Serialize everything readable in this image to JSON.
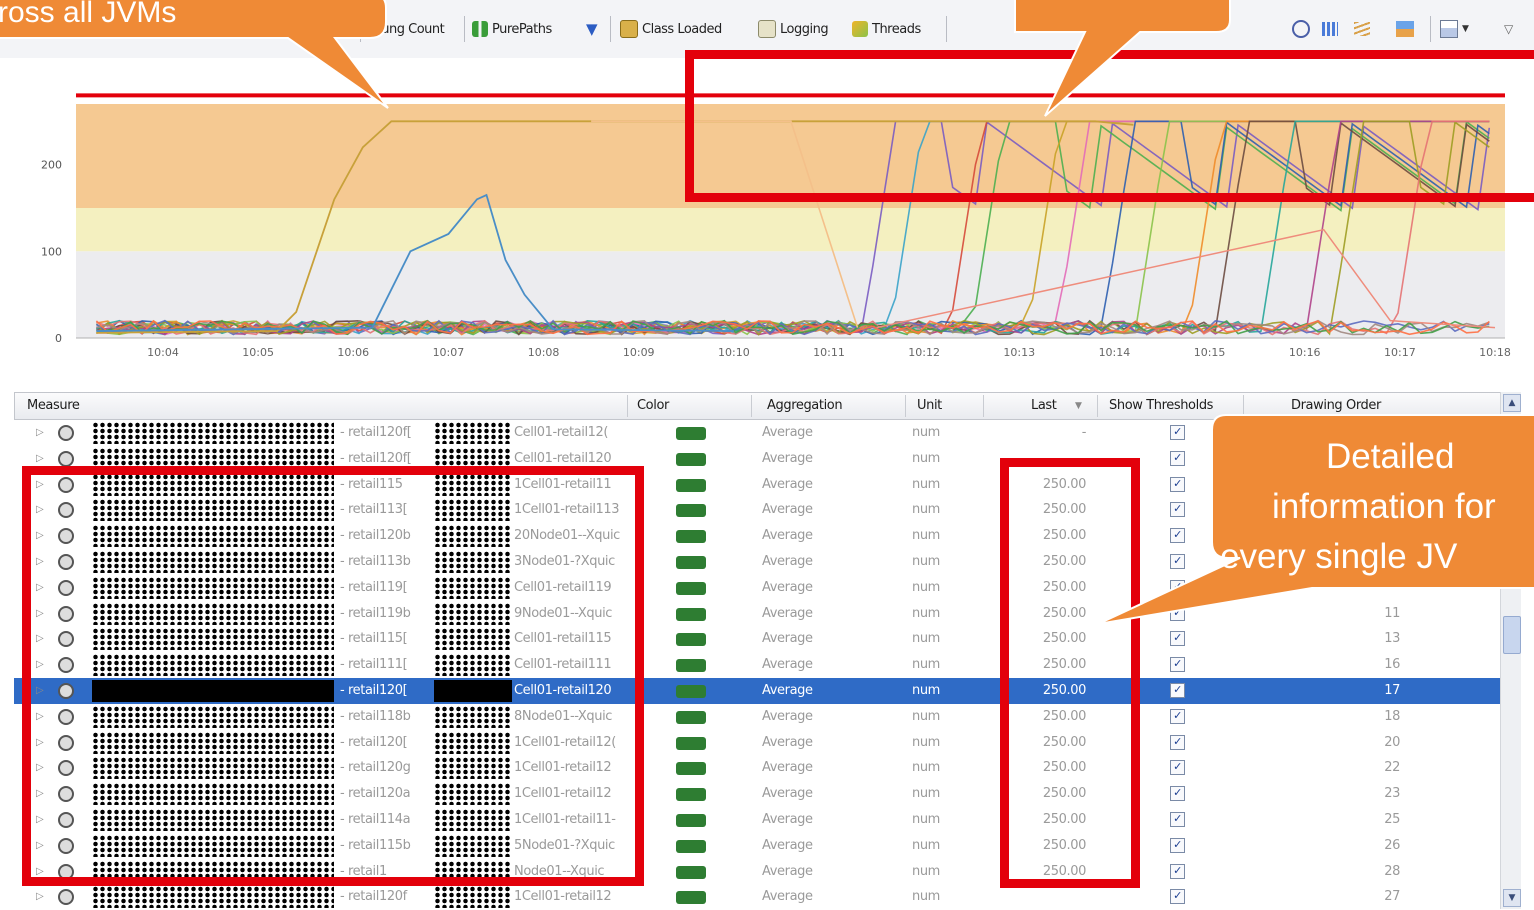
{
  "toolbar": {
    "items": [
      {
        "label": "Hung Count",
        "icon": "hung-count-icon"
      },
      {
        "label": "PurePaths",
        "icon": "purepaths-icon"
      },
      {
        "label": "Class Loaded",
        "icon": "class-loaded-icon"
      },
      {
        "label": "Logging",
        "icon": "logging-icon"
      },
      {
        "label": "Threads",
        "icon": "threads-icon"
      }
    ],
    "right_icons": [
      "pin-icon",
      "chart-bars-icon",
      "chart-lines-icon",
      "chart-stack-icon",
      "layout-icon",
      "dropdown-icon",
      "view-menu-icon"
    ]
  },
  "chart": {
    "y_ticks": [
      "0",
      "100",
      "200"
    ],
    "x_ticks": [
      "10:04",
      "10:05",
      "10:06",
      "10:07",
      "10:08",
      "10:09",
      "10:10",
      "10:11",
      "10:12",
      "10:13",
      "10:14",
      "10:15",
      "10:16",
      "10:17",
      "10:18"
    ]
  },
  "grid": {
    "columns": [
      "Measure",
      "Color",
      "Aggregation",
      "Unit",
      "Last",
      "Show Thresholds",
      "Drawing Order"
    ],
    "sort_indicator": "▼",
    "rows": [
      {
        "mid": "- retail120f[",
        "right": "Cell01-retail12(",
        "agg": "Average",
        "unit": "num",
        "last": "-",
        "order": ""
      },
      {
        "mid": "- retail120f[",
        "right": "Cell01-retail120",
        "agg": "Average",
        "unit": "num",
        "last": "",
        "order": ""
      },
      {
        "mid": "- retail115",
        "right": "1Cell01-retail11",
        "agg": "Average",
        "unit": "num",
        "last": "250.00",
        "order": ""
      },
      {
        "mid": "- retail113[",
        "right": "1Cell01-retail113",
        "agg": "Average",
        "unit": "num",
        "last": "250.00",
        "order": ""
      },
      {
        "mid": "- retail120b",
        "right": "20Node01--Xquic",
        "agg": "Average",
        "unit": "num",
        "last": "250.00",
        "order": ""
      },
      {
        "mid": "- retail113b",
        "right": "3Node01-?Xquic",
        "agg": "Average",
        "unit": "num",
        "last": "250.00",
        "order": ""
      },
      {
        "mid": "- retail119[",
        "right": "Cell01-retail119",
        "agg": "Average",
        "unit": "num",
        "last": "250.00",
        "order": ""
      },
      {
        "mid": "- retail119b",
        "right": "9Node01--Xquic",
        "agg": "Average",
        "unit": "num",
        "last": "250.00",
        "order": "11"
      },
      {
        "mid": "- retail115[",
        "right": "Cell01-retail115",
        "agg": "Average",
        "unit": "num",
        "last": "250.00",
        "order": "13"
      },
      {
        "mid": "- retail111[",
        "right": "Cell01-retail111",
        "agg": "Average",
        "unit": "num",
        "last": "250.00",
        "order": "16"
      },
      {
        "mid": "- retail120[",
        "right": "Cell01-retail120",
        "agg": "Average",
        "unit": "num",
        "last": "250.00",
        "order": "17"
      },
      {
        "mid": "- retail118b",
        "right": "8Node01--Xquic",
        "agg": "Average",
        "unit": "num",
        "last": "250.00",
        "order": "18"
      },
      {
        "mid": "- retail120[",
        "right": "1Cell01-retail12(",
        "agg": "Average",
        "unit": "num",
        "last": "250.00",
        "order": "20"
      },
      {
        "mid": "- retail120g",
        "right": "1Cell01-retail12",
        "agg": "Average",
        "unit": "num",
        "last": "250.00",
        "order": "22"
      },
      {
        "mid": "- retail120a",
        "right": "1Cell01-retail12",
        "agg": "Average",
        "unit": "num",
        "last": "250.00",
        "order": "23"
      },
      {
        "mid": "- retail114a",
        "right": "1Cell01-retail11-",
        "agg": "Average",
        "unit": "num",
        "last": "250.00",
        "order": "25"
      },
      {
        "mid": "- retail115b",
        "right": "5Node01-?Xquic",
        "agg": "Average",
        "unit": "num",
        "last": "250.00",
        "order": "26"
      },
      {
        "mid": "- retail1",
        "right": "Node01--Xquic",
        "agg": "Average",
        "unit": "num",
        "last": "250.00",
        "order": "28"
      },
      {
        "mid": "- retail120f",
        "right": "1Cell01-retail12",
        "agg": "Average",
        "unit": "num",
        "last": "",
        "order": "27"
      }
    ],
    "selected_index": 10
  },
  "callouts": {
    "left": "ross all JVMs",
    "right_line1": "Detailed",
    "right_line2": "information for",
    "right_line3": "every single JV"
  },
  "colors": {
    "callout": "#ef8a36",
    "highlight": "#e3000b",
    "selection": "#2f6bc6",
    "swatch": "#2e7d32"
  }
}
